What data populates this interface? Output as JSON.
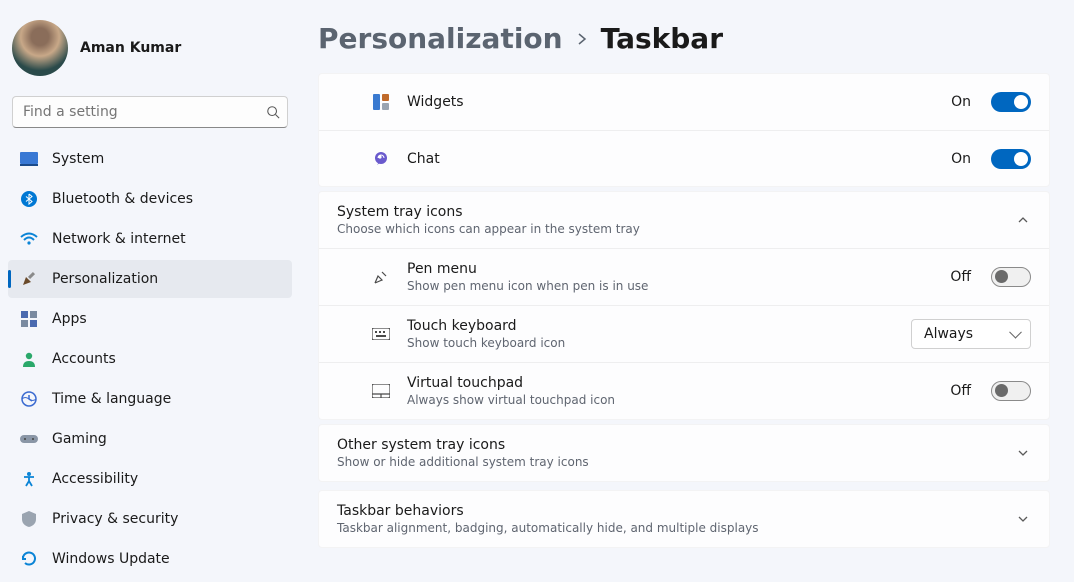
{
  "user": {
    "name": "Aman Kumar"
  },
  "search": {
    "placeholder": "Find a setting"
  },
  "nav": {
    "system": "System",
    "bluetooth": "Bluetooth & devices",
    "network": "Network & internet",
    "personalization": "Personalization",
    "apps": "Apps",
    "accounts": "Accounts",
    "time": "Time & language",
    "gaming": "Gaming",
    "accessibility": "Accessibility",
    "privacy": "Privacy & security",
    "update": "Windows Update"
  },
  "breadcrumb": {
    "parent": "Personalization",
    "current": "Taskbar"
  },
  "items": {
    "widgets": {
      "label": "Widgets",
      "state": "On"
    },
    "chat": {
      "label": "Chat",
      "state": "On"
    }
  },
  "tray": {
    "title": "System tray icons",
    "sub": "Choose which icons can appear in the system tray",
    "pen": {
      "label": "Pen menu",
      "sub": "Show pen menu icon when pen is in use",
      "state": "Off"
    },
    "touch": {
      "label": "Touch keyboard",
      "sub": "Show touch keyboard icon",
      "value": "Always"
    },
    "vtouch": {
      "label": "Virtual touchpad",
      "sub": "Always show virtual touchpad icon",
      "state": "Off"
    }
  },
  "other": {
    "title": "Other system tray icons",
    "sub": "Show or hide additional system tray icons"
  },
  "behaviors": {
    "title": "Taskbar behaviors",
    "sub": "Taskbar alignment, badging, automatically hide, and multiple displays"
  }
}
